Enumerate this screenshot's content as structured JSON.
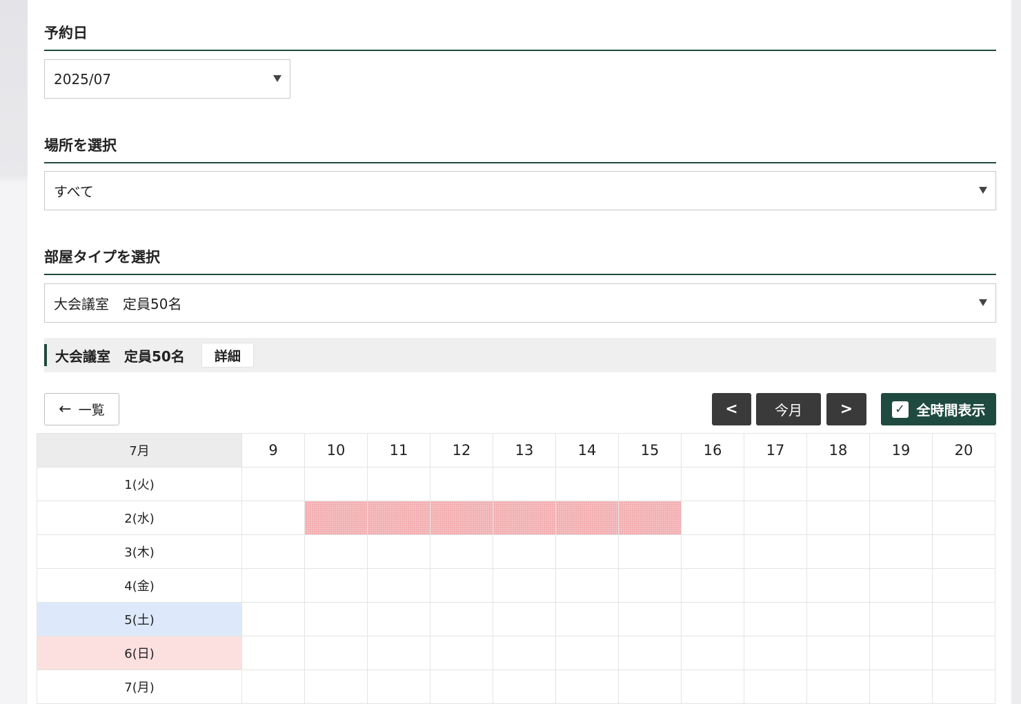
{
  "sections": {
    "date": {
      "title": "予約日",
      "value": "2025/07"
    },
    "place": {
      "title": "場所を選択",
      "value": "すべて"
    },
    "room_type": {
      "title": "部屋タイプを選択",
      "value": "大会議室　定員50名"
    }
  },
  "room": {
    "name": "大会議室　定員50名",
    "detail_label": "詳細"
  },
  "controls": {
    "back_label": "一覧",
    "prev_label": "<",
    "today_label": "今月",
    "next_label": ">",
    "all_hours_label": "全時間表示",
    "all_hours_checked": true
  },
  "calendar": {
    "month_label": "7月",
    "hours": [
      "9",
      "10",
      "11",
      "12",
      "13",
      "14",
      "15",
      "16",
      "17",
      "18",
      "19",
      "20"
    ],
    "days": [
      {
        "label": "1(火)",
        "type": "weekday",
        "booked": []
      },
      {
        "label": "2(水)",
        "type": "weekday",
        "booked": [
          "10",
          "11",
          "12",
          "13",
          "14",
          "15"
        ]
      },
      {
        "label": "3(木)",
        "type": "weekday",
        "booked": []
      },
      {
        "label": "4(金)",
        "type": "weekday",
        "booked": []
      },
      {
        "label": "5(土)",
        "type": "sat",
        "booked": []
      },
      {
        "label": "6(日)",
        "type": "sun",
        "booked": []
      },
      {
        "label": "7(月)",
        "type": "weekday",
        "booked": []
      }
    ]
  },
  "colors": {
    "accent": "#1f4a3f",
    "saturday": "#dde9fb",
    "sunday": "#fce0e0",
    "booked": "#f6c2c4"
  }
}
